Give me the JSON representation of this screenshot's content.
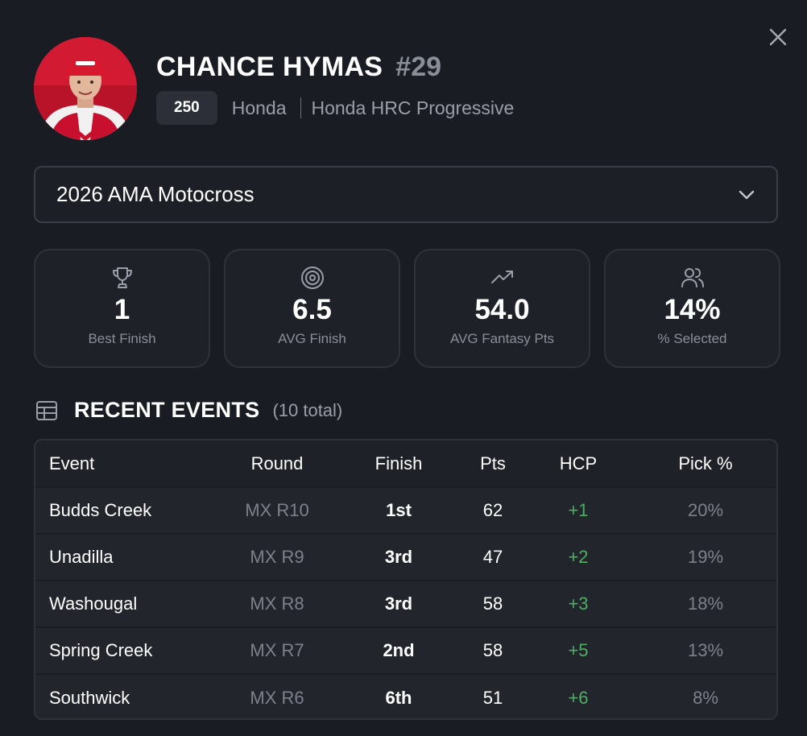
{
  "rider": {
    "name": "CHANCE HYMAS",
    "number": "#29",
    "class": "250",
    "manufacturer": "Honda",
    "team": "Honda HRC Progressive"
  },
  "season_select": {
    "value": "2026 AMA Motocross"
  },
  "stats": [
    {
      "icon": "trophy-icon",
      "value": "1",
      "label": "Best Finish"
    },
    {
      "icon": "target-icon",
      "value": "6.5",
      "label": "AVG Finish"
    },
    {
      "icon": "trending-up-icon",
      "value": "54.0",
      "label": "AVG Fantasy Pts"
    },
    {
      "icon": "users-icon",
      "value": "14%",
      "label": "% Selected"
    }
  ],
  "recent_events": {
    "title": "RECENT EVENTS",
    "count": "(10 total)",
    "columns": [
      "Event",
      "Round",
      "Finish",
      "Pts",
      "HCP",
      "Pick %"
    ],
    "rows": [
      {
        "event": "Budds Creek",
        "round": "MX R10",
        "finish": "1st",
        "pts": "62",
        "hcp": "+1",
        "pick": "20%"
      },
      {
        "event": "Unadilla",
        "round": "MX R9",
        "finish": "3rd",
        "pts": "47",
        "hcp": "+2",
        "pick": "19%"
      },
      {
        "event": "Washougal",
        "round": "MX R8",
        "finish": "3rd",
        "pts": "58",
        "hcp": "+3",
        "pick": "18%"
      },
      {
        "event": "Spring Creek",
        "round": "MX R7",
        "finish": "2nd",
        "pts": "58",
        "hcp": "+5",
        "pick": "13%"
      },
      {
        "event": "Southwick",
        "round": "MX R6",
        "finish": "6th",
        "pts": "51",
        "hcp": "+6",
        "pick": "8%"
      }
    ]
  },
  "colors": {
    "background": "#1a1c23",
    "card": "#1f2128",
    "row": "#22252c",
    "muted_text": "#8a8e99",
    "positive": "#4caf62",
    "rider_red": "#c8102e"
  }
}
